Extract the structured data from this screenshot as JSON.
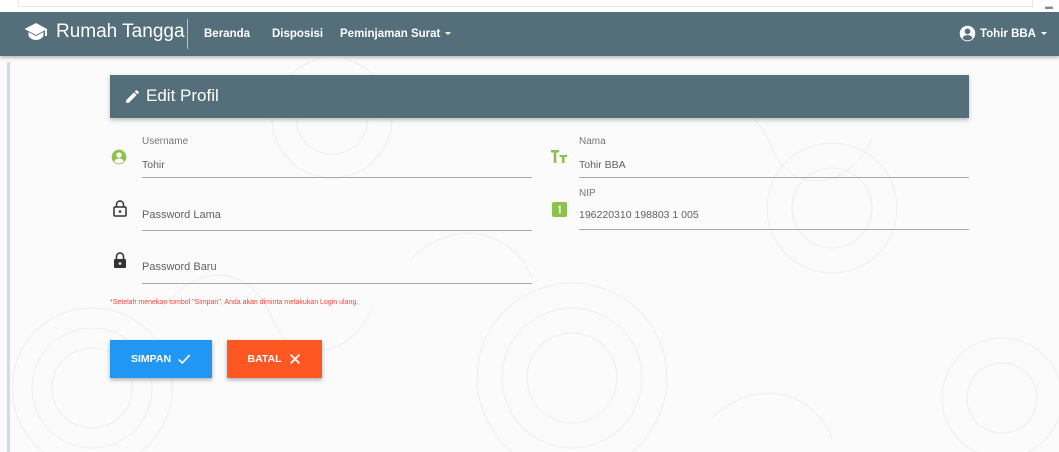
{
  "navbar": {
    "brand": "Rumah Tangga",
    "links": {
      "beranda": "Beranda",
      "disposisi": "Disposisi",
      "peminjaman": "Peminjaman Surat"
    },
    "user": "Tohir BBA",
    "icons": {
      "brand": "graduation-cap-icon",
      "user": "account-circle-icon"
    }
  },
  "card": {
    "title": "Edit Profil",
    "icon": "pencil-icon"
  },
  "form": {
    "username": {
      "label": "Username",
      "value": "Tohir",
      "icon": "account-circle-icon"
    },
    "password_old": {
      "placeholder": "Password Lama",
      "icon": "lock-open-icon"
    },
    "password_new": {
      "placeholder": "Password Baru",
      "icon": "lock-icon"
    },
    "nama": {
      "label": "Nama",
      "value": "Tohir BBA",
      "icon": "format-size-icon"
    },
    "nip": {
      "label": "NIP",
      "value": "196220310 198803 1 005",
      "icon": "numeric-box-icon"
    }
  },
  "note": "*Setelah menekan tombol \"Simpan\", Anda akan diminta melakukan Login ulang.",
  "buttons": {
    "save": "SIMPAN",
    "cancel": "BATAL"
  },
  "colors": {
    "navbar": "#546e7a",
    "icon_green": "#8bc34a",
    "save": "#2196f3",
    "cancel": "#ff5722",
    "note": "#f44336"
  }
}
